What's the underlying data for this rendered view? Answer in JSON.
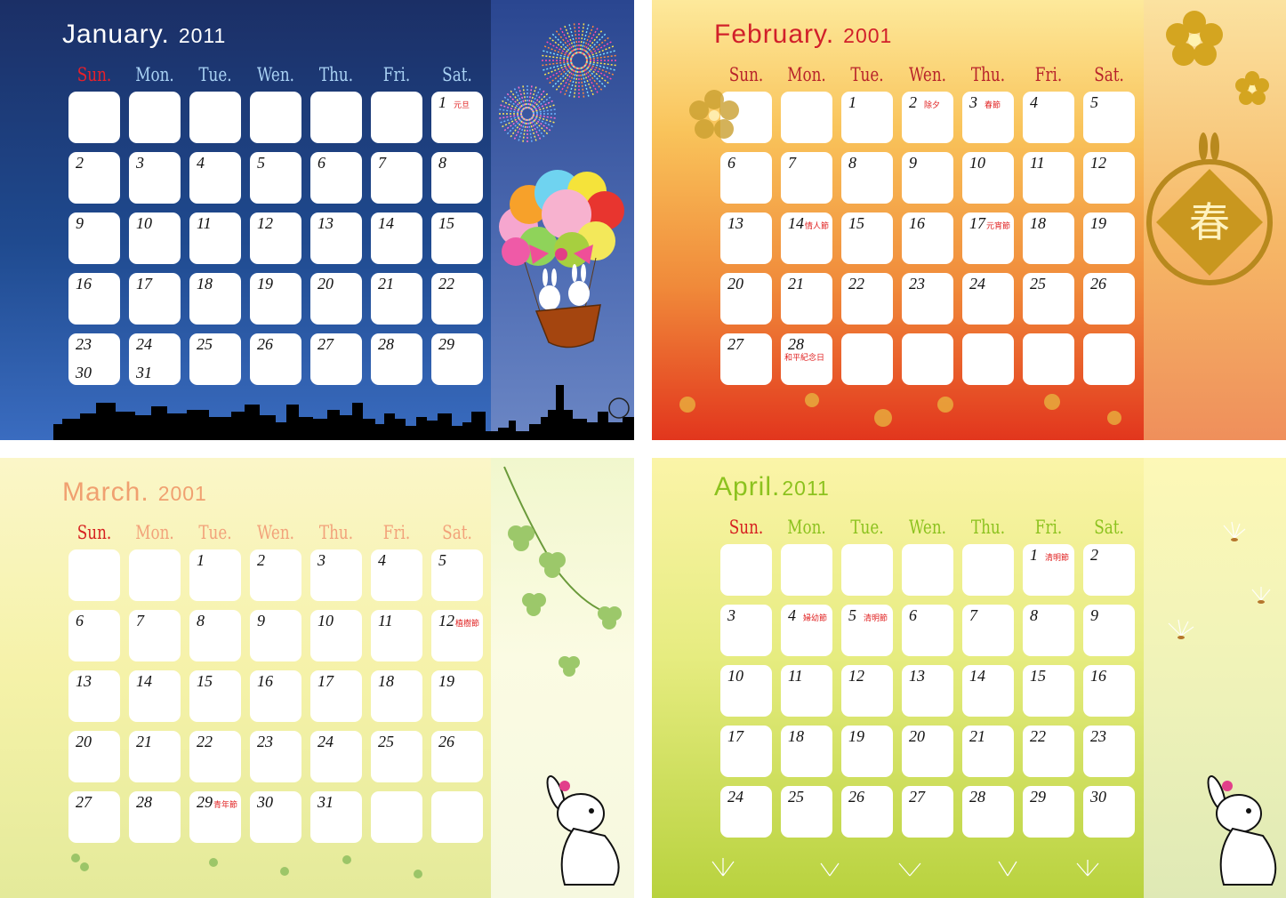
{
  "weekdays": [
    "Sun.",
    "Mon.",
    "Tue.",
    "Wen.",
    "Thu.",
    "Fri.",
    "Sat."
  ],
  "months": [
    {
      "month": "January.",
      "year": "2011",
      "colors": {
        "title": "#ffffff",
        "sun": "#e8202a",
        "days": "#a9d2f4"
      },
      "weeks": [
        [
          {
            "d": ""
          },
          {
            "d": ""
          },
          {
            "d": ""
          },
          {
            "d": ""
          },
          {
            "d": ""
          },
          {
            "d": ""
          },
          {
            "d": "1",
            "h": "元旦"
          }
        ],
        [
          {
            "d": "2"
          },
          {
            "d": "3"
          },
          {
            "d": "4"
          },
          {
            "d": "5"
          },
          {
            "d": "6"
          },
          {
            "d": "7"
          },
          {
            "d": "8"
          }
        ],
        [
          {
            "d": "9"
          },
          {
            "d": "10"
          },
          {
            "d": "11"
          },
          {
            "d": "12"
          },
          {
            "d": "13"
          },
          {
            "d": "14"
          },
          {
            "d": "15"
          }
        ],
        [
          {
            "d": "16"
          },
          {
            "d": "17"
          },
          {
            "d": "18"
          },
          {
            "d": "19"
          },
          {
            "d": "20"
          },
          {
            "d": "21"
          },
          {
            "d": "22"
          }
        ],
        [
          {
            "d": "23",
            "d2": "30"
          },
          {
            "d": "24",
            "d2": "31"
          },
          {
            "d": "25"
          },
          {
            "d": "26"
          },
          {
            "d": "27"
          },
          {
            "d": "28"
          },
          {
            "d": "29"
          }
        ]
      ]
    },
    {
      "month": "February.",
      "year": "2001",
      "colors": {
        "title": "#d1202a",
        "sun": "#b8232a",
        "days": "#b8232a"
      },
      "weeks": [
        [
          {
            "d": ""
          },
          {
            "d": ""
          },
          {
            "d": "1"
          },
          {
            "d": "2",
            "h": "除夕"
          },
          {
            "d": "3",
            "h": "春節"
          },
          {
            "d": "4"
          },
          {
            "d": "5"
          }
        ],
        [
          {
            "d": "6"
          },
          {
            "d": "7"
          },
          {
            "d": "8"
          },
          {
            "d": "9"
          },
          {
            "d": "10"
          },
          {
            "d": "11"
          },
          {
            "d": "12"
          }
        ],
        [
          {
            "d": "13"
          },
          {
            "d": "14",
            "h": "情人節"
          },
          {
            "d": "15"
          },
          {
            "d": "16"
          },
          {
            "d": "17",
            "h": "元宵節"
          },
          {
            "d": "18"
          },
          {
            "d": "19"
          }
        ],
        [
          {
            "d": "20"
          },
          {
            "d": "21"
          },
          {
            "d": "22"
          },
          {
            "d": "23"
          },
          {
            "d": "24"
          },
          {
            "d": "25"
          },
          {
            "d": "26"
          }
        ],
        [
          {
            "d": "27"
          },
          {
            "d": "28",
            "h": "和平紀念日"
          },
          {
            "d": ""
          },
          {
            "d": ""
          },
          {
            "d": ""
          },
          {
            "d": ""
          },
          {
            "d": ""
          }
        ]
      ]
    },
    {
      "month": "March.",
      "year": "2001",
      "colors": {
        "title": "#f0a070",
        "sun": "#d62020",
        "days": "#f2a27a"
      },
      "weeks": [
        [
          {
            "d": ""
          },
          {
            "d": ""
          },
          {
            "d": "1"
          },
          {
            "d": "2"
          },
          {
            "d": "3"
          },
          {
            "d": "4"
          },
          {
            "d": "5"
          }
        ],
        [
          {
            "d": "6"
          },
          {
            "d": "7"
          },
          {
            "d": "8"
          },
          {
            "d": "9"
          },
          {
            "d": "10"
          },
          {
            "d": "11"
          },
          {
            "d": "12",
            "h": "植樹節"
          }
        ],
        [
          {
            "d": "13"
          },
          {
            "d": "14"
          },
          {
            "d": "15"
          },
          {
            "d": "16"
          },
          {
            "d": "17"
          },
          {
            "d": "18"
          },
          {
            "d": "19"
          }
        ],
        [
          {
            "d": "20"
          },
          {
            "d": "21"
          },
          {
            "d": "22"
          },
          {
            "d": "23"
          },
          {
            "d": "24"
          },
          {
            "d": "25"
          },
          {
            "d": "26"
          }
        ],
        [
          {
            "d": "27"
          },
          {
            "d": "28"
          },
          {
            "d": "29",
            "h": "青年節"
          },
          {
            "d": "30"
          },
          {
            "d": "31"
          },
          {
            "d": ""
          },
          {
            "d": ""
          }
        ]
      ]
    },
    {
      "month": "April.",
      "year": "2011",
      "colors": {
        "title": "#8cc21e",
        "sun": "#d62020",
        "days": "#8cc21e"
      },
      "weeks": [
        [
          {
            "d": ""
          },
          {
            "d": ""
          },
          {
            "d": ""
          },
          {
            "d": ""
          },
          {
            "d": ""
          },
          {
            "d": "1",
            "h": "清明節"
          },
          {
            "d": "2"
          }
        ],
        [
          {
            "d": "3"
          },
          {
            "d": "4",
            "h": "婦幼節"
          },
          {
            "d": "5",
            "h": "清明節"
          },
          {
            "d": "6"
          },
          {
            "d": "7"
          },
          {
            "d": "8"
          },
          {
            "d": "9"
          }
        ],
        [
          {
            "d": "10"
          },
          {
            "d": "11"
          },
          {
            "d": "12"
          },
          {
            "d": "13"
          },
          {
            "d": "14"
          },
          {
            "d": "15"
          },
          {
            "d": "16"
          }
        ],
        [
          {
            "d": "17"
          },
          {
            "d": "18"
          },
          {
            "d": "19"
          },
          {
            "d": "20"
          },
          {
            "d": "21"
          },
          {
            "d": "22"
          },
          {
            "d": "23"
          }
        ],
        [
          {
            "d": "24"
          },
          {
            "d": "25"
          },
          {
            "d": "26"
          },
          {
            "d": "27"
          },
          {
            "d": "28"
          },
          {
            "d": "29"
          },
          {
            "d": "30"
          }
        ]
      ]
    }
  ],
  "decorations": [
    {
      "name": "fireworks-icon"
    },
    {
      "name": "hot-air-balloon-icon"
    },
    {
      "name": "city-skyline-icon"
    },
    {
      "name": "plum-blossom-icon"
    },
    {
      "name": "spring-emblem-icon"
    },
    {
      "name": "clover-icon"
    },
    {
      "name": "rabbit-icon"
    },
    {
      "name": "dandelion-seed-icon"
    }
  ]
}
